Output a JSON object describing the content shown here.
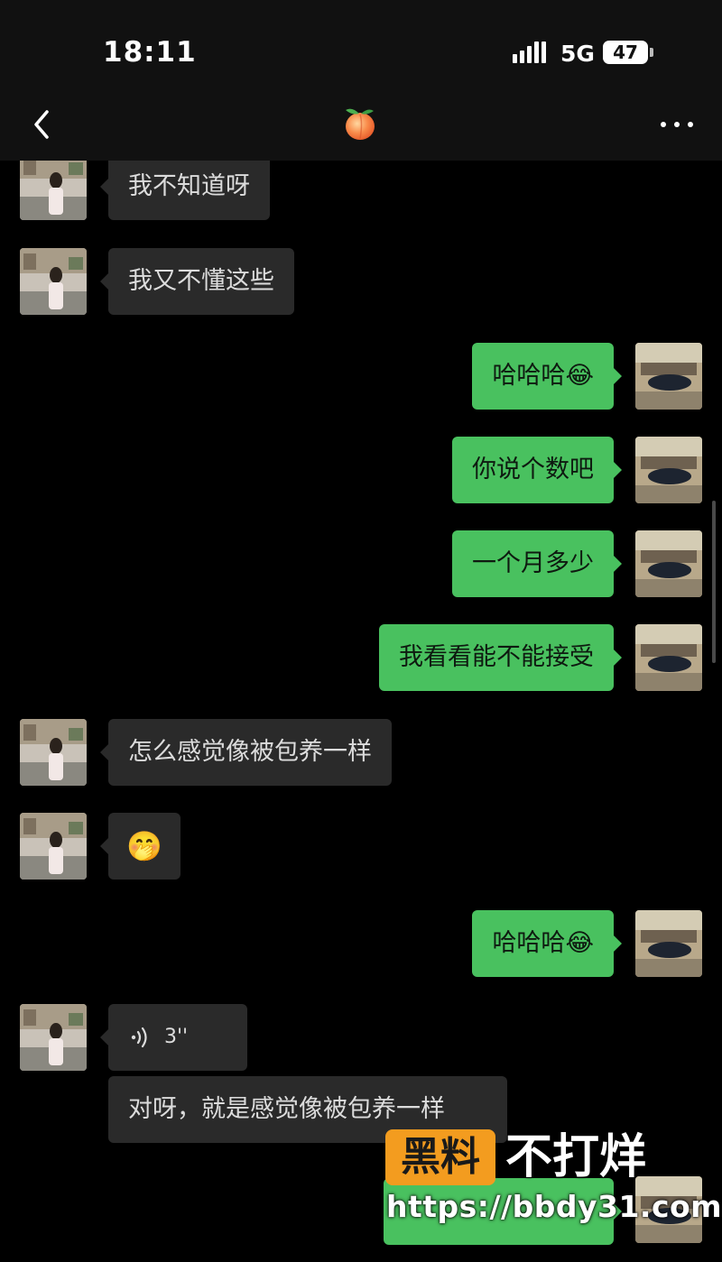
{
  "status_bar": {
    "time": "18:11",
    "network": "5G",
    "battery": "47"
  },
  "nav": {
    "back_icon": "chevron-left-icon",
    "title_icon": "peach-emoji",
    "menu_icon": "more-dots-icon"
  },
  "messages": [
    {
      "side": "in",
      "text": "我不知道呀"
    },
    {
      "side": "in",
      "text": "我又不懂这些"
    },
    {
      "side": "out",
      "text": "哈哈哈",
      "emoji": "😂"
    },
    {
      "side": "out",
      "text": "你说个数吧"
    },
    {
      "side": "out",
      "text": "一个月多少"
    },
    {
      "side": "out",
      "text": "我看看能不能接受"
    },
    {
      "side": "in",
      "text": "怎么感觉像被包养一样"
    },
    {
      "side": "in",
      "emoji": "🤭"
    },
    {
      "side": "out",
      "text": "哈哈哈",
      "emoji": "😂"
    },
    {
      "side": "in",
      "voice_duration": "3''"
    },
    {
      "side": "in",
      "text": "对呀，就是感觉像被包养一样"
    }
  ],
  "watermark": {
    "brand": "黑料",
    "slogan": "不打烊",
    "url": "https://bbdy31.com"
  },
  "colors": {
    "background": "#000000",
    "bar": "#111111",
    "incoming_bubble": "#2a2a2a",
    "outgoing_bubble": "#49c15f",
    "watermark_accent": "#f39c1f"
  }
}
